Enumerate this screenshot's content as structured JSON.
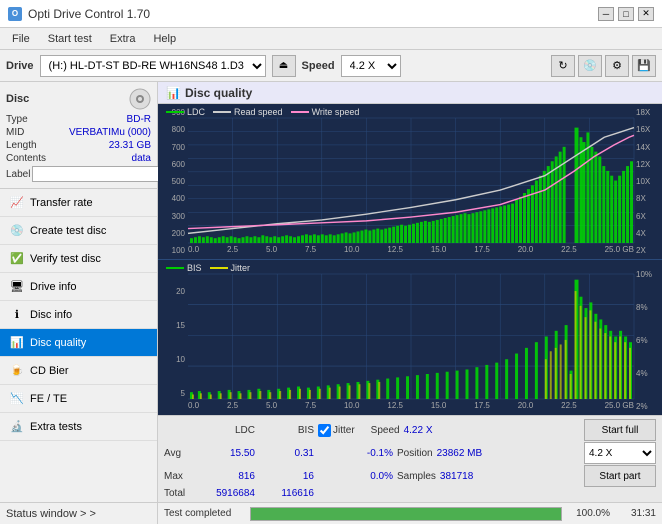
{
  "titleBar": {
    "title": "Opti Drive Control 1.70",
    "minimize": "─",
    "maximize": "□",
    "close": "✕"
  },
  "menuBar": {
    "items": [
      "File",
      "Start test",
      "Extra",
      "Help"
    ]
  },
  "driveBar": {
    "label": "Drive",
    "driveValue": "(H:)  HL-DT-ST BD-RE  WH16NS48 1.D3",
    "speedLabel": "Speed",
    "speedValue": "4.2 X"
  },
  "disc": {
    "title": "Disc",
    "typeLabel": "Type",
    "typeValue": "BD-R",
    "midLabel": "MID",
    "midValue": "VERBATIMu (000)",
    "lengthLabel": "Length",
    "lengthValue": "23.31 GB",
    "contentsLabel": "Contents",
    "contentsValue": "data",
    "labelLabel": "Label"
  },
  "navItems": [
    {
      "id": "transfer-rate",
      "label": "Transfer rate",
      "icon": "📈"
    },
    {
      "id": "create-test-disc",
      "label": "Create test disc",
      "icon": "💿"
    },
    {
      "id": "verify-test-disc",
      "label": "Verify test disc",
      "icon": "✅"
    },
    {
      "id": "drive-info",
      "label": "Drive info",
      "icon": "🖥"
    },
    {
      "id": "disc-info",
      "label": "Disc info",
      "icon": "ℹ"
    },
    {
      "id": "disc-quality",
      "label": "Disc quality",
      "icon": "📊",
      "active": true
    },
    {
      "id": "cd-bier",
      "label": "CD Bier",
      "icon": "🍺"
    },
    {
      "id": "fe-te",
      "label": "FE / TE",
      "icon": "📉"
    },
    {
      "id": "extra-tests",
      "label": "Extra tests",
      "icon": "🔬"
    }
  ],
  "statusWindow": {
    "label": "Status window > >"
  },
  "discQuality": {
    "title": "Disc quality",
    "legendTop": {
      "ldc": "LDC",
      "readSpeed": "Read speed",
      "writeSpeed": "Write speed"
    },
    "legendBottom": {
      "bis": "BIS",
      "jitter": "Jitter"
    },
    "topChart": {
      "yLeftLabels": [
        "900",
        "800",
        "700",
        "600",
        "500",
        "400",
        "300",
        "200",
        "100"
      ],
      "yRightLabels": [
        "18X",
        "16X",
        "14X",
        "12X",
        "10X",
        "8X",
        "6X",
        "4X",
        "2X"
      ],
      "xLabels": [
        "0.0",
        "2.5",
        "5.0",
        "7.5",
        "10.0",
        "12.5",
        "15.0",
        "17.5",
        "20.0",
        "22.5",
        "25.0 GB"
      ]
    },
    "bottomChart": {
      "yLeftLabels": [
        "20",
        "15",
        "10",
        "5"
      ],
      "yRightLabels": [
        "10%",
        "8%",
        "6%",
        "4%",
        "2%"
      ],
      "xLabels": [
        "0.0",
        "2.5",
        "5.0",
        "7.5",
        "10.0",
        "12.5",
        "15.0",
        "17.5",
        "20.0",
        "22.5",
        "25.0 GB"
      ]
    }
  },
  "stats": {
    "avgLabel": "Avg",
    "maxLabel": "Max",
    "totalLabel": "Total",
    "ldcAvg": "15.50",
    "ldcMax": "816",
    "ldcTotal": "5916684",
    "bisAvg": "0.31",
    "bisMax": "16",
    "bisTotal": "116616",
    "jitterAvg": "-0.1%",
    "jitterMax": "0.0%",
    "jitterTotal": "",
    "jitterLabel": "Jitter",
    "speedLabel": "Speed",
    "speedValue": "4.22 X",
    "positionLabel": "Position",
    "positionValue": "23862 MB",
    "samplesLabel": "Samples",
    "samplesValue": "381718",
    "speedDropdown": "4.2 X"
  },
  "buttons": {
    "startFull": "Start full",
    "startPart": "Start part"
  },
  "progress": {
    "label": "Test completed",
    "percent": "100.0%",
    "percentValue": 100,
    "time": "31:31"
  },
  "columns": {
    "ldc": "LDC",
    "bis": "BIS",
    "jitter": "Jitter"
  }
}
